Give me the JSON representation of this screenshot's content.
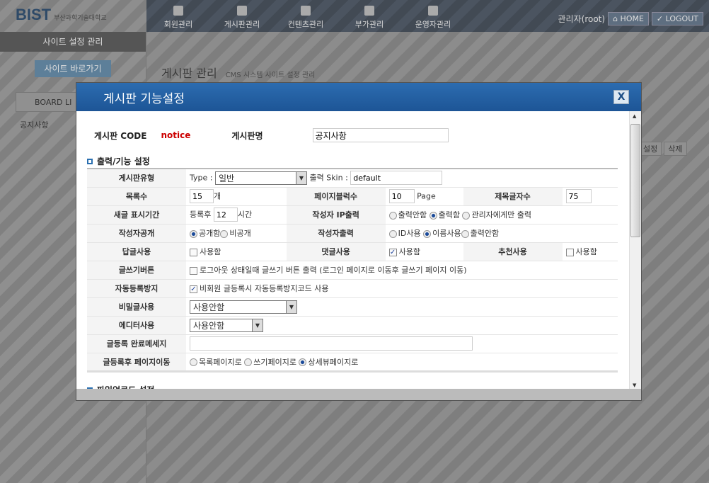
{
  "header": {
    "logo_text": "BIST",
    "logo_sub": "부산과학기술대학교",
    "nav": [
      "회원관리",
      "게시판관리",
      "컨텐츠관리",
      "부가관리",
      "운영자관리"
    ],
    "user": "관리자(root)",
    "home": "HOME",
    "logout": "LOGOUT"
  },
  "sidebar": {
    "title": "사이트 설정 관리",
    "site_button": "사이트 바로가기",
    "board_tab": "BOARD LI",
    "board_item": "공지사항"
  },
  "main": {
    "title": "게시판 관리",
    "subtitle": "CMS 시스템 사이트 설정 관리",
    "btn_setting": "설정",
    "btn_delete": "삭제"
  },
  "modal": {
    "title": "게시판 기능설정",
    "close": "X",
    "code_label": "게시판 CODE",
    "code_value": "notice",
    "name_label": "게시판명",
    "name_value": "공지사항",
    "section1": "출력/기능 설정",
    "section2": "파일업로드 설정",
    "rows": {
      "type_label": "게시판유형",
      "type_prefix": "Type :",
      "type_value": "일반",
      "skin_label": "출력 Skin :",
      "skin_value": "default",
      "list_label": "목록수",
      "list_value": "15",
      "list_unit": "개",
      "page_label": "페이지블럭수",
      "page_value": "10",
      "page_unit": "Page",
      "subject_label": "제목글자수",
      "subject_value": "75",
      "new_label": "새글 표시기간",
      "new_prefix": "등록후",
      "new_value": "12",
      "new_unit": "시간",
      "ip_label": "작성자 IP출력",
      "ip_opts": [
        "출력안함",
        "출력함",
        "관리자에게만 출력"
      ],
      "open_label": "작성자공개",
      "open_opts": [
        "공개함",
        "비공개"
      ],
      "writer_label": "작성자출력",
      "writer_opts": [
        "ID사용",
        "이름사용",
        "출력안함"
      ],
      "reply_label": "답글사용",
      "reply_opt": "사용함",
      "comment_label": "댓글사용",
      "comment_opt": "사용함",
      "recommend_label": "추천사용",
      "recommend_opt": "사용함",
      "write_btn_label": "글쓰기버튼",
      "write_btn_opt": "로그아웃 상태일때 글쓰기 버튼 출력 (로그인 페이지로 이동후 글쓰기 페이지 이동)",
      "spam_label": "자동등록방지",
      "spam_opt": "비회원 글등록시 자동등록방지코드 사용",
      "secret_label": "비밀글사용",
      "secret_value": "사용안함",
      "editor_label": "에디터사용",
      "editor_value": "사용안함",
      "done_label": "글등록 완료메세지",
      "done_value": "",
      "after_label": "글등록후 페이지이동",
      "after_opts": [
        "목록페이지로",
        "쓰기페이지로",
        "상세뷰페이지로"
      ]
    }
  }
}
